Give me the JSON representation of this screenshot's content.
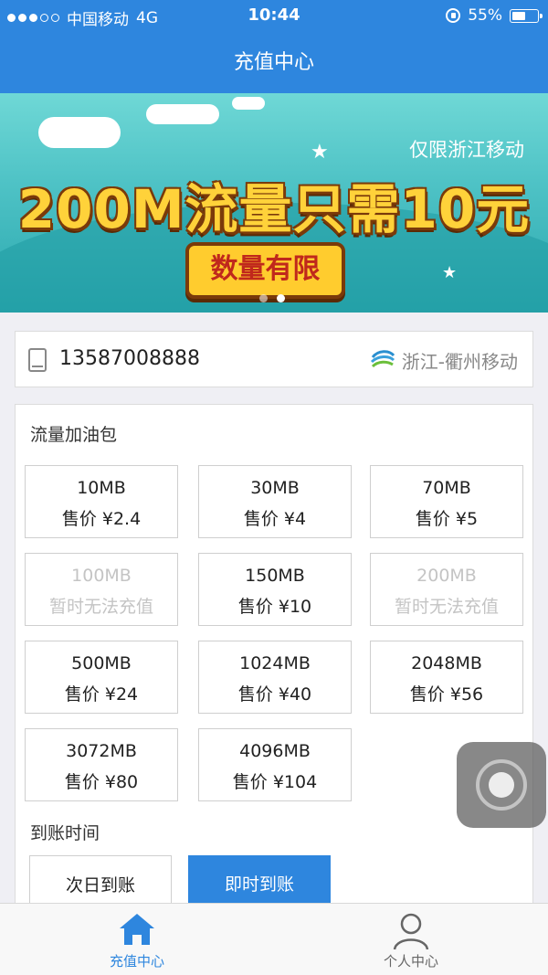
{
  "status_bar": {
    "carrier": "中国移动",
    "network": "4G",
    "time": "10:44",
    "battery_percent": "55%",
    "battery_level": 0.55
  },
  "nav": {
    "title": "充值中心"
  },
  "banner": {
    "tag": "仅限浙江移动",
    "headline": "200M流量只需10元",
    "button": "数量有限",
    "page_count": 2,
    "active_page": 2
  },
  "phone": {
    "number": "13587008888",
    "carrier": "浙江-衢州移动",
    "icon": "phone-icon",
    "carrier_icon": "china-mobile-logo-icon"
  },
  "packages": {
    "title": "流量加油包",
    "items": [
      {
        "size": "10MB",
        "price": "售价 ¥2.4",
        "enabled": true
      },
      {
        "size": "30MB",
        "price": "售价 ¥4",
        "enabled": true
      },
      {
        "size": "70MB",
        "price": "售价 ¥5",
        "enabled": true
      },
      {
        "size": "100MB",
        "price": "暂时无法充值",
        "enabled": false
      },
      {
        "size": "150MB",
        "price": "售价 ¥10",
        "enabled": true
      },
      {
        "size": "200MB",
        "price": "暂时无法充值",
        "enabled": false
      },
      {
        "size": "500MB",
        "price": "售价 ¥24",
        "enabled": true
      },
      {
        "size": "1024MB",
        "price": "售价 ¥40",
        "enabled": true
      },
      {
        "size": "2048MB",
        "price": "售价 ¥56",
        "enabled": true
      },
      {
        "size": "3072MB",
        "price": "售价 ¥80",
        "enabled": true
      },
      {
        "size": "4096MB",
        "price": "售价 ¥104",
        "enabled": true
      }
    ]
  },
  "arrival": {
    "title": "到账时间",
    "options": [
      "次日到账",
      "即时到账"
    ],
    "selected": "即时到账"
  },
  "tabbar": {
    "home": {
      "label": "充值中心",
      "icon": "home-icon",
      "active": true
    },
    "me": {
      "label": "个人中心",
      "icon": "person-icon",
      "active": false
    }
  },
  "colors": {
    "primary": "#2e86de",
    "banner": "#4fc3c6",
    "headline": "#ffd23a"
  }
}
